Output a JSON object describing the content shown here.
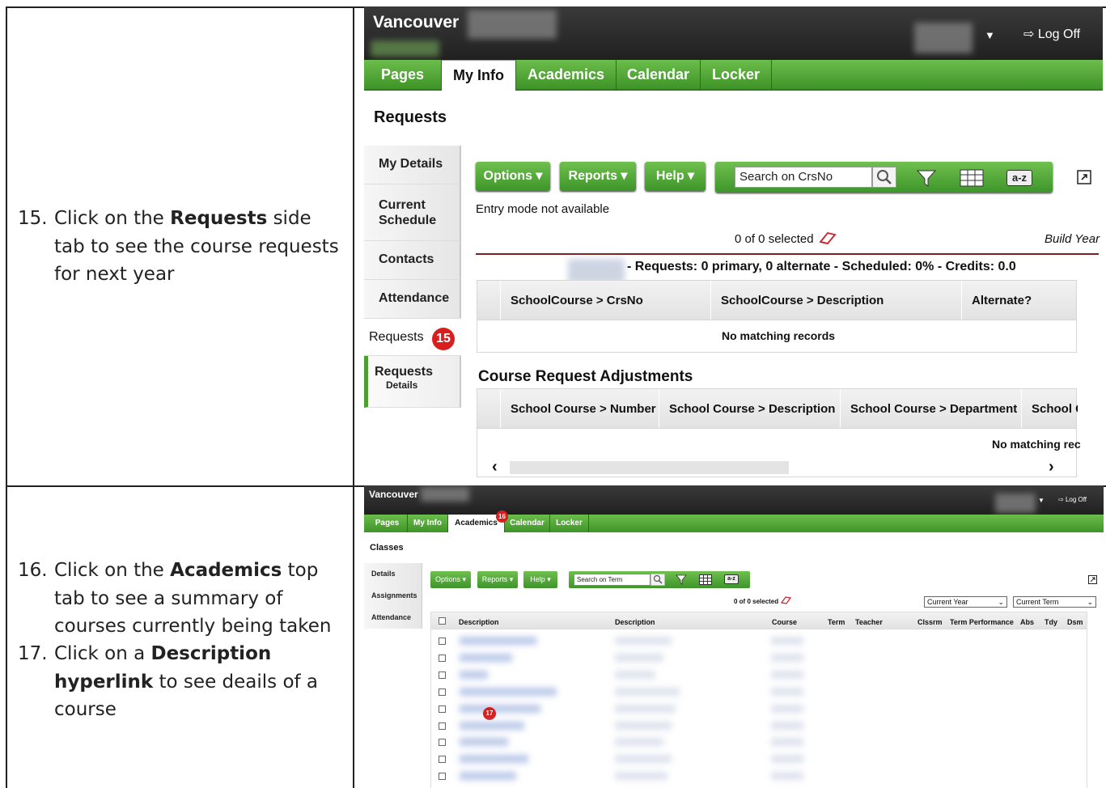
{
  "step15": {
    "num": "15.",
    "pre": "Click on the ",
    "bold": "Requests",
    "post": " side tab to see the course requests for next year"
  },
  "step16": {
    "num": "16.",
    "pre": "Click on the ",
    "bold": "Academics",
    "post": " top tab to see a summary of courses currently being taken"
  },
  "step17": {
    "num": "17.",
    "pre": "Click on a ",
    "bold1": "Description",
    "bold2": "hyperlink",
    "post": " to see deails of a course"
  },
  "shot1": {
    "brand": "Vancouver",
    "logoff": "Log Off",
    "tabs": [
      "Pages",
      "My Info",
      "Academics",
      "Calendar",
      "Locker"
    ],
    "page_title": "Requests",
    "side_tabs": [
      "My Details",
      "Current Schedule",
      "Contacts",
      "Attendance"
    ],
    "side_active": "Requests",
    "callout": "15",
    "side_sub_title": "Requests",
    "side_sub_detail": "Details",
    "buttons": {
      "options": "Options",
      "reports": "Reports",
      "help": "Help"
    },
    "search_placeholder": "Search on CrsNo",
    "az": "a-z",
    "entry_mode": "Entry mode not available",
    "selected": "0 of 0 selected",
    "build_year": "Build Year",
    "summary": "- Requests: 0 primary, 0 alternate - Scheduled: 0% - Credits: 0.0",
    "grid1_headers": [
      "SchoolCourse > CrsNo",
      "SchoolCourse > Description",
      "Alternate?"
    ],
    "no_records": "No matching records",
    "adjustments_title": "Course Request Adjustments",
    "grid2_headers": [
      "School Course > Number",
      "School Course > Description",
      "School Course > Department",
      "School C"
    ],
    "no_records_cut": "No matching rec"
  },
  "shot2": {
    "brand": "Vancouver",
    "logoff": "Log Off",
    "tabs": [
      "Pages",
      "My Info",
      "Academics",
      "Calendar",
      "Locker"
    ],
    "callout16": "16",
    "callout17": "17",
    "page_title": "Classes",
    "side_tabs": [
      "Details",
      "Assignments",
      "Attendance"
    ],
    "buttons": {
      "options": "Options",
      "reports": "Reports",
      "help": "Help"
    },
    "search_placeholder": "Search on Term",
    "az": "a-z",
    "selected": "0 of 0 selected",
    "year_select": "Current Year",
    "term_select": "Current Term",
    "headers": [
      "Description",
      "Description",
      "Course",
      "Term",
      "Teacher",
      "Clssrm",
      "Term Performance",
      "Abs",
      "Tdy",
      "Dsm"
    ]
  }
}
